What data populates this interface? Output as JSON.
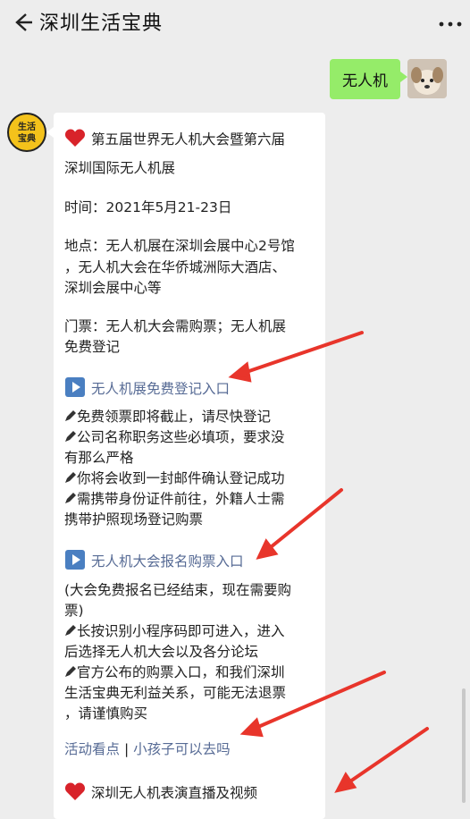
{
  "header": {
    "title": "深圳生活宝典",
    "back_icon": "chevron-left-icon",
    "more_icon": "more-dots-icon"
  },
  "outgoing": {
    "text": "无人机"
  },
  "reply": {
    "heading1": "第五届世界无人机大会暨第六届",
    "heading1_cont": "深圳国际无人机展",
    "time": "时间：2021年5月21-23日",
    "place1": "地点：无人机展在深圳会展中心2号馆",
    "place2": "，无人机大会在华侨城洲际大酒店、",
    "place3": "深圳会展中心等",
    "ticket1": "门票：无人机大会需购票；无人机展",
    "ticket2": "免费登记",
    "link1": "无人机展免费登记入口",
    "b1": "免费领票即将截止，请尽快登记",
    "b2": "公司名称职务这些必填项，要求没",
    "b2c": "有那么严格",
    "b3": "你将会收到一封邮件确认登记成功",
    "b4": "需携带身份证件前往，外籍人士需",
    "b4c": "携带护照现场登记购票",
    "link2": "无人机大会报名购票入口",
    "note1": "(大会免费报名已经结束，现在需要购",
    "note2": "票)",
    "b5": "长按识别小程序码即可进入，进入",
    "b5c": "后选择无人机大会以及各分论坛",
    "b6": "官方公布的购票入口，和我们深圳",
    "b6c": "生活宝典无利益关系，可能无法退票",
    "b6d": "，请谨慎购买",
    "link3a": "活动看点",
    "sep": "|",
    "link3b": "小孩子可以去吗",
    "heading2": "深圳无人机表演直播及视频"
  },
  "bot_avatar_text": [
    "生活",
    "宝典"
  ],
  "colors": {
    "link": "#576b95",
    "bubble_green": "#95ec69",
    "arrow": "#e8352b",
    "heart": "#d8232a",
    "play": "#4a7fc1"
  }
}
